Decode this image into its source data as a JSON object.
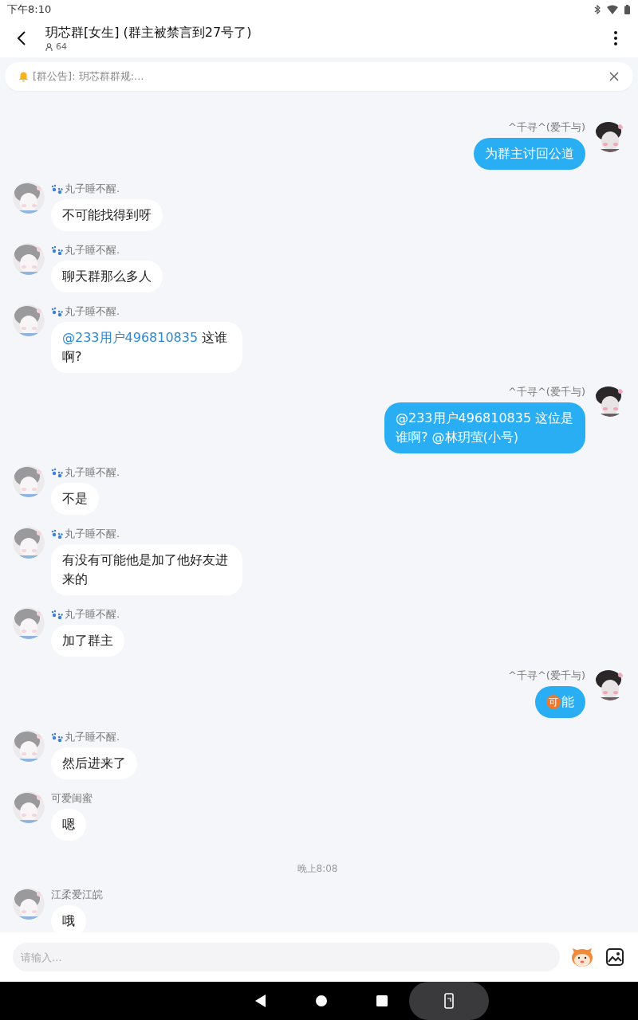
{
  "status_bar": {
    "time": "下午8:10"
  },
  "header": {
    "title": "玥芯群[女生] (群主被禁言到27号了)",
    "member_count": "64"
  },
  "notice": {
    "text": "[群公告]: 玥芯群群规:..."
  },
  "messages": [
    {
      "kind": "message",
      "outgoing": true,
      "sender": "^千寻^(爱千与)",
      "parts": [
        {
          "kind": "text",
          "text": "为群主讨回公道"
        }
      ]
    },
    {
      "kind": "message",
      "outgoing": false,
      "sender": "丸子睡不醒.",
      "paw_mark": true,
      "parts": [
        {
          "kind": "text",
          "text": "不可能找得到呀"
        }
      ]
    },
    {
      "kind": "message",
      "outgoing": false,
      "sender": "丸子睡不醒.",
      "paw_mark": true,
      "parts": [
        {
          "kind": "text",
          "text": "聊天群那么多人"
        }
      ]
    },
    {
      "kind": "message",
      "outgoing": false,
      "sender": "丸子睡不醒.",
      "paw_mark": true,
      "parts": [
        {
          "kind": "mention",
          "text": "@233用户496810835"
        },
        {
          "kind": "text",
          "text": " 这谁啊?"
        }
      ]
    },
    {
      "kind": "message",
      "outgoing": true,
      "sender": "^千寻^(爱千与)",
      "parts": [
        {
          "kind": "text",
          "text": "@233用户496810835 这位是谁啊? @林玥萤(小号)"
        }
      ]
    },
    {
      "kind": "message",
      "outgoing": false,
      "sender": "丸子睡不醒.",
      "paw_mark": true,
      "parts": [
        {
          "kind": "text",
          "text": "不是"
        }
      ]
    },
    {
      "kind": "message",
      "outgoing": false,
      "sender": "丸子睡不醒.",
      "paw_mark": true,
      "parts": [
        {
          "kind": "text",
          "text": "有没有可能他是加了他好友进来的"
        }
      ]
    },
    {
      "kind": "message",
      "outgoing": false,
      "sender": "丸子睡不醒.",
      "paw_mark": true,
      "parts": [
        {
          "kind": "text",
          "text": "加了群主"
        }
      ]
    },
    {
      "kind": "message",
      "outgoing": true,
      "sender": "^千寻^(爱千与)",
      "parts": [
        {
          "kind": "emoji",
          "text": "可"
        },
        {
          "kind": "text",
          "text": "能"
        }
      ]
    },
    {
      "kind": "message",
      "outgoing": false,
      "sender": "丸子睡不醒.",
      "paw_mark": true,
      "parts": [
        {
          "kind": "text",
          "text": "然后进来了"
        }
      ]
    },
    {
      "kind": "message",
      "outgoing": false,
      "sender": "可爱闺蜜",
      "paw_mark": false,
      "parts": [
        {
          "kind": "text",
          "text": "嗯"
        }
      ]
    },
    {
      "kind": "time",
      "text": "晚上8:08"
    },
    {
      "kind": "message",
      "outgoing": false,
      "sender": "江柔爱江皖",
      "paw_mark": false,
      "parts": [
        {
          "kind": "text",
          "text": "哦"
        }
      ]
    }
  ],
  "input": {
    "placeholder": "请输入..."
  }
}
